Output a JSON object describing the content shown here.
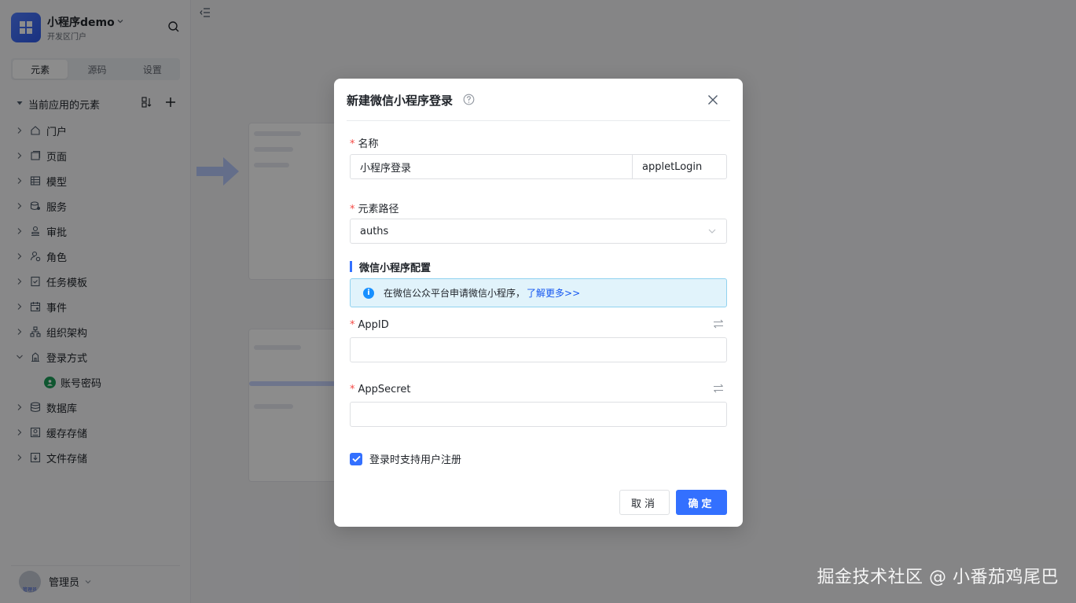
{
  "app": {
    "name": "小程序demo",
    "subtitle": "开发区门户"
  },
  "sidebar": {
    "tabs": [
      {
        "label": "元素",
        "active": true
      },
      {
        "label": "源码",
        "active": false
      },
      {
        "label": "设置",
        "active": false
      }
    ],
    "tree_header": "当前应用的元素",
    "items": [
      {
        "label": "门户",
        "icon": "home-icon",
        "expanded": false
      },
      {
        "label": "页面",
        "icon": "page-icon",
        "expanded": false
      },
      {
        "label": "模型",
        "icon": "table-icon",
        "expanded": false
      },
      {
        "label": "服务",
        "icon": "service-icon",
        "expanded": false
      },
      {
        "label": "审批",
        "icon": "approval-icon",
        "expanded": false
      },
      {
        "label": "角色",
        "icon": "role-icon",
        "expanded": false
      },
      {
        "label": "任务模板",
        "icon": "task-icon",
        "expanded": false
      },
      {
        "label": "事件",
        "icon": "event-icon",
        "expanded": false
      },
      {
        "label": "组织架构",
        "icon": "org-icon",
        "expanded": false
      },
      {
        "label": "登录方式",
        "icon": "login-icon",
        "expanded": true
      },
      {
        "label": "数据库",
        "icon": "database-icon",
        "expanded": false
      },
      {
        "label": "缓存存储",
        "icon": "cache-icon",
        "expanded": false
      },
      {
        "label": "文件存储",
        "icon": "file-storage-icon",
        "expanded": false
      }
    ],
    "login_children": [
      {
        "label": "账号密码",
        "icon": "account-icon"
      }
    ],
    "user": {
      "name": "管理员",
      "avatar_text": "管理员"
    }
  },
  "modal": {
    "title": "新建微信小程序登录",
    "fields": {
      "name": {
        "label": "名称",
        "value": "小程序登录",
        "code_value": "appletLogin"
      },
      "path": {
        "label": "元素路径",
        "value": "auths"
      },
      "appid": {
        "label": "AppID",
        "value": ""
      },
      "appsecret": {
        "label": "AppSecret",
        "value": ""
      }
    },
    "section_title": "微信小程序配置",
    "info": {
      "text": "在微信公众平台申请微信小程序，",
      "link": "了解更多>>"
    },
    "checkbox": {
      "label": "登录时支持用户注册",
      "checked": true
    },
    "buttons": {
      "cancel": "取消",
      "ok": "确定"
    }
  },
  "watermark": "掘金技术社区 @ 小番茄鸡尾巴",
  "colors": {
    "primary": "#3370ff",
    "required": "#f54a45",
    "info_bg": "#e1f3fb",
    "link": "#1456f0"
  }
}
